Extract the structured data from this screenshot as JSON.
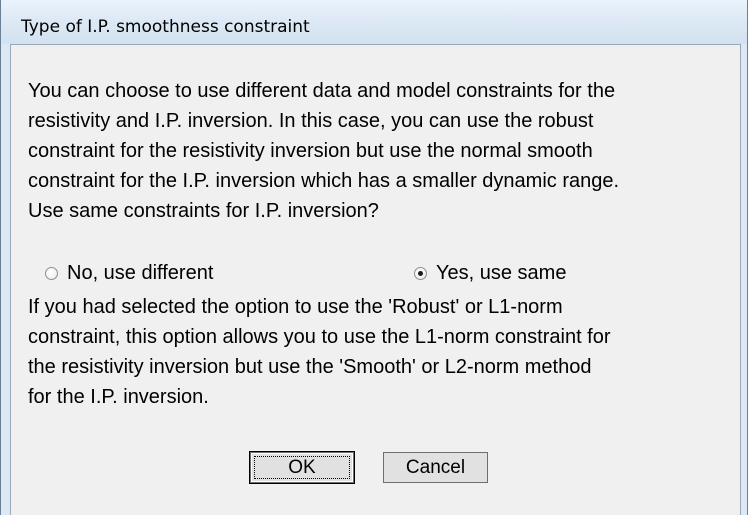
{
  "window": {
    "title": "Type of I.P. smoothness constraint"
  },
  "body": {
    "paragraph1": [
      "You can choose to use different data and model constraints for the",
      "resistivity and I.P. inversion. In this case, you can use the robust",
      "constraint for the resistivity inversion but use the normal smooth",
      "constraint for the I.P. inversion which has a smaller dynamic range.",
      "Use same constraints for I.P. inversion?"
    ],
    "options": [
      {
        "label": "No, use different",
        "checked": false
      },
      {
        "label": "Yes, use same",
        "checked": true
      }
    ],
    "paragraph2": [
      "If you had selected the option to use the 'Robust' or L1-norm",
      "constraint, this option allows you to use the L1-norm constraint for",
      "the resistivity inversion but use the 'Smooth' or L2-norm method",
      "for the I.P. inversion."
    ]
  },
  "buttons": {
    "ok_label": "OK",
    "cancel_label": "Cancel"
  }
}
